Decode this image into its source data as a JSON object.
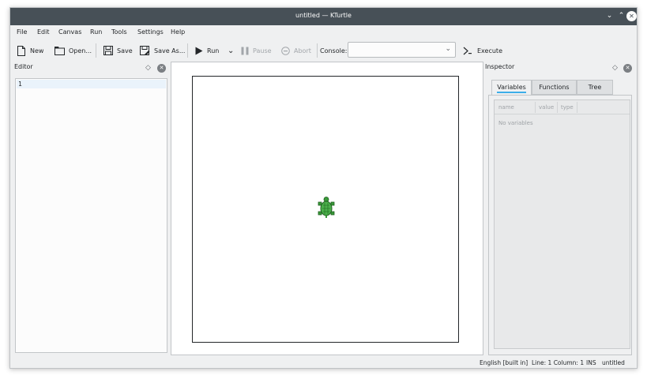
{
  "window": {
    "title": "untitled — KTurtle"
  },
  "menu": [
    "File",
    "Edit",
    "Canvas",
    "Run",
    "Tools",
    "Settings",
    "Help"
  ],
  "toolbar": {
    "new": "New",
    "open": "Open...",
    "save": "Save",
    "save_as": "Save As...",
    "run": "Run",
    "pause": "Pause",
    "abort": "Abort",
    "console_label": "Console:",
    "console_value": "",
    "execute": "Execute"
  },
  "editor": {
    "title": "Editor",
    "line_number": "1"
  },
  "inspector": {
    "title": "Inspector",
    "tabs": [
      "Variables",
      "Functions",
      "Tree"
    ],
    "columns": [
      "name",
      "value",
      "type"
    ],
    "empty": "No variables"
  },
  "status": {
    "language": "English [built in]",
    "position": "Line: 1 Column: 1",
    "mode": "INS",
    "file": "untitled"
  },
  "colors": {
    "titlebar": "#475057",
    "accent": "#3daee9",
    "turtle": "#3a9a3a"
  }
}
